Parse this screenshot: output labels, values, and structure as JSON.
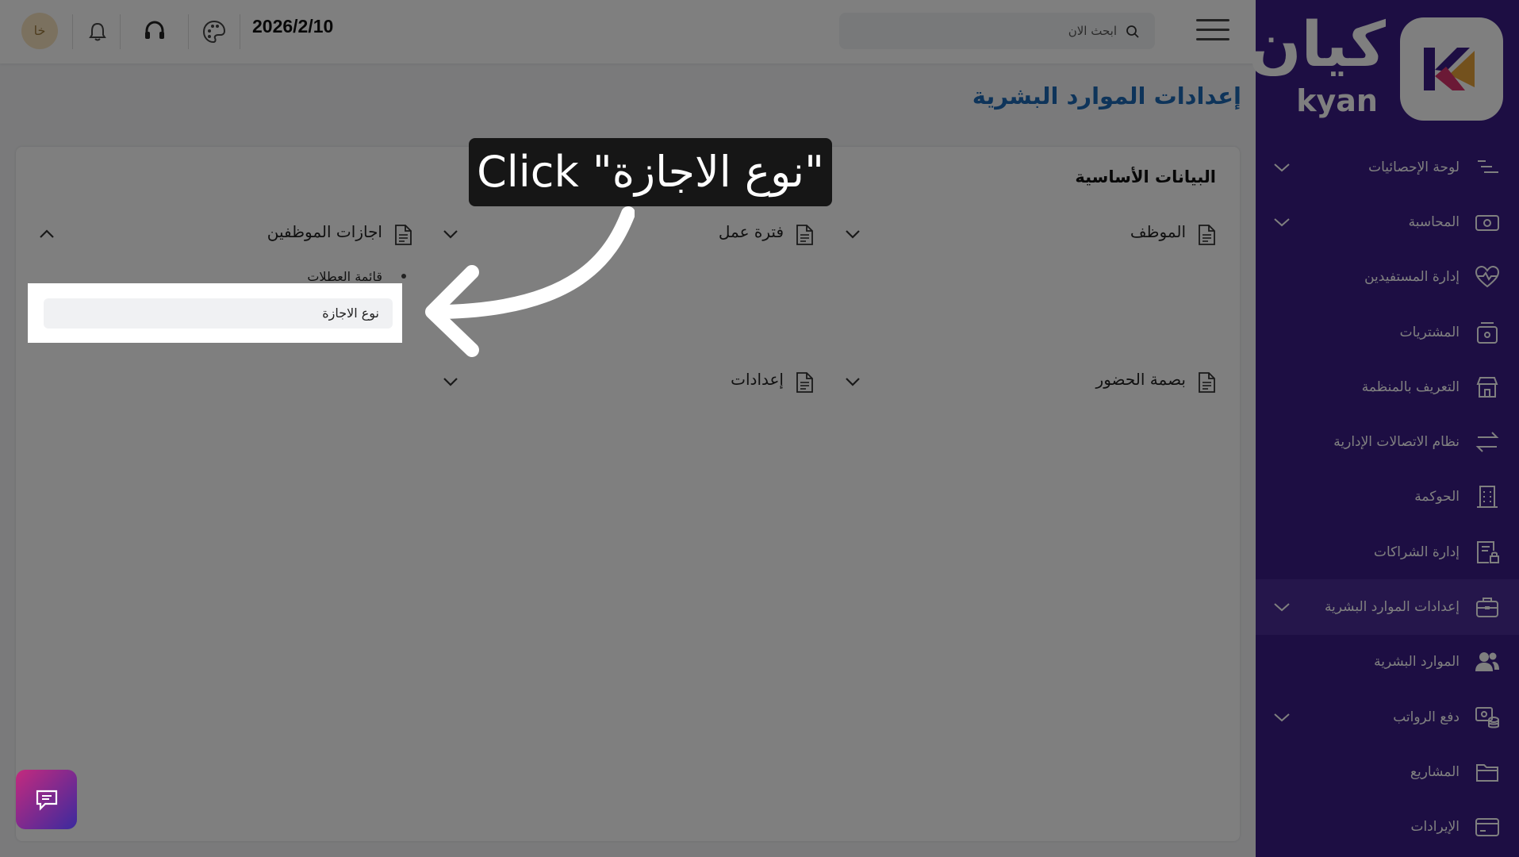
{
  "sidebar": {
    "logo_ar": "كيان",
    "logo_en": "kyan",
    "items": [
      {
        "label": "لوحة الإحصائيات",
        "icon": "stats-lines-icon",
        "has_chevron": true
      },
      {
        "label": "المحاسبة",
        "icon": "money-icon",
        "has_chevron": true
      },
      {
        "label": "إدارة المستفيدين",
        "icon": "heart-pulse-icon",
        "has_chevron": false
      },
      {
        "label": "المشتريات",
        "icon": "purchase-box-icon",
        "has_chevron": false
      },
      {
        "label": "التعريف بالمنظمة",
        "icon": "store-icon",
        "has_chevron": false
      },
      {
        "label": "نظام الاتصالات الإدارية",
        "icon": "transfer-arrows-icon",
        "has_chevron": false
      },
      {
        "label": "الحوكمة",
        "icon": "building-icon",
        "has_chevron": false
      },
      {
        "label": "إدارة الشراكات",
        "icon": "document-lock-icon",
        "has_chevron": false
      },
      {
        "label": "إعدادات الموارد البشرية",
        "icon": "briefcase-icon",
        "has_chevron": true,
        "active": true
      },
      {
        "label": "الموارد البشرية",
        "icon": "users-icon",
        "has_chevron": false
      },
      {
        "label": "دفع الرواتب",
        "icon": "coins-icon",
        "has_chevron": true
      },
      {
        "label": "المشاريع",
        "icon": "folder-icon",
        "has_chevron": false
      },
      {
        "label": "الإيرادات",
        "icon": "card-icon",
        "has_chevron": false
      }
    ]
  },
  "header": {
    "search_placeholder": "ابحث الان",
    "date": "2026/2/10",
    "avatar_initials": "خا"
  },
  "page": {
    "title": "إعدادات الموارد البشرية",
    "section_title": "البيانات الأساسية",
    "menus": {
      "employee": "الموظف",
      "work_period": "فترة عمل",
      "employee_leaves": "اجازات الموظفين",
      "attendance": "بصمة الحضور",
      "settings": "إعدادات"
    },
    "leaves_submenu": [
      "قائمة العطلات",
      "نوع الاجازة"
    ]
  },
  "tutorial": {
    "callout_text": "Click \"نوع الاجازة\""
  },
  "colors": {
    "sidebar_bg": "#3a1c86",
    "title_blue": "#1c68b5",
    "overlay": "rgba(0,0,0,0.5)"
  }
}
